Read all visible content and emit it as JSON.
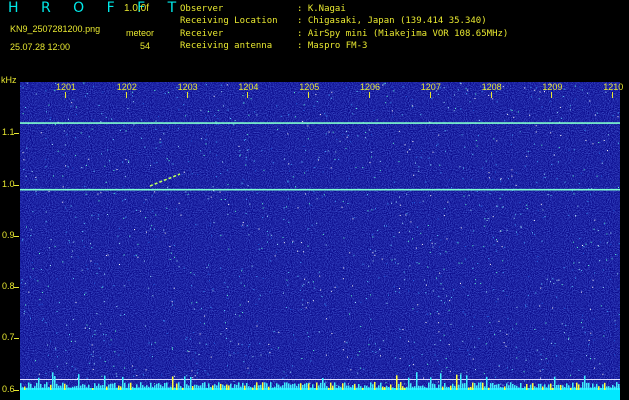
{
  "header": {
    "brand": "H R O F F T",
    "version": "1.0.0f",
    "filename": "KN9_2507281200.png",
    "datetime": "25.07.28 12:00",
    "meteor_label": "meteor",
    "meteor_count": "54",
    "fields": [
      {
        "label": "Observer",
        "value": ": K.Nagai"
      },
      {
        "label": "Receiving Location",
        "value": ": Chigasaki, Japan (139.414 35.340)"
      },
      {
        "label": "Receiver",
        "value": ": AirSpy mini (Miakejima VOR 108.65MHz)"
      },
      {
        "label": "Receiving antenna",
        "value": ": Maspro FM-3"
      }
    ]
  },
  "y_unit": "kHz",
  "colors": {
    "label": "#e8e830",
    "brand": "#00e8e8",
    "background": "#0a0a8c",
    "trace": "#80ffd0",
    "floor": "#00e8ff"
  },
  "chart_data": {
    "type": "heatmap",
    "x_ticks": [
      "1201",
      "1202",
      "1203",
      "1204",
      "1205",
      "1206",
      "1207",
      "1208",
      "1209",
      "1210"
    ],
    "y_ticks": [
      "1.1",
      "1.0",
      "0.9",
      "0.8",
      "0.7",
      "0.6"
    ],
    "ylim": [
      0.58,
      1.2
    ],
    "carrier_lines_khz": [
      1.12,
      0.99,
      0.62,
      0.6
    ],
    "meteor_count": 54
  }
}
